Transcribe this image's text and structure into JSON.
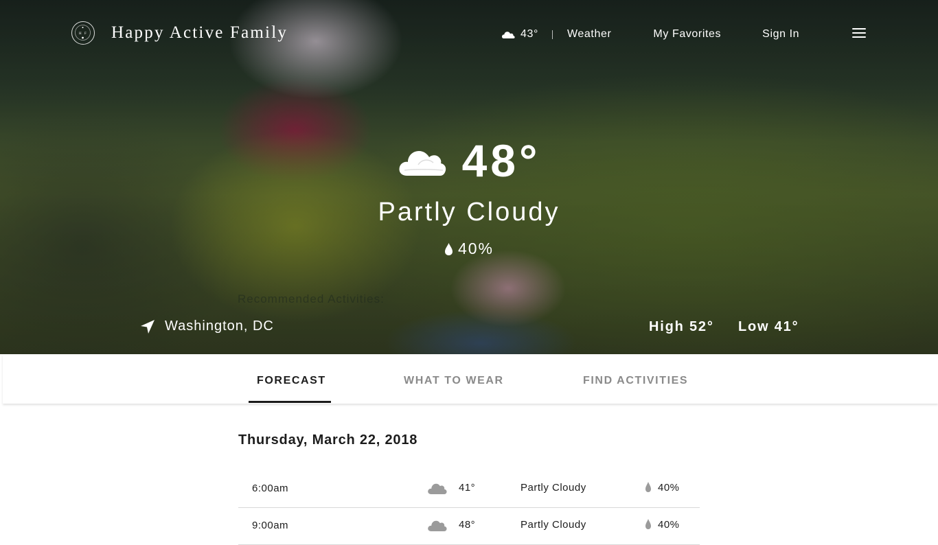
{
  "brand": {
    "name": "Happy Active Family"
  },
  "nav": {
    "weather_temp": "43°",
    "weather_icon": "cloud-icon",
    "links": [
      "Weather",
      "My Favorites",
      "Sign In"
    ],
    "menu_icon": "hamburger-menu-icon"
  },
  "current": {
    "temp": "48°",
    "condition": "Partly Cloudy",
    "precip": "40%",
    "ghost_text": "Recommended Activities:",
    "location": "Washington, DC",
    "high": "High 52°",
    "low": "Low 41°"
  },
  "tabs": [
    {
      "label": "FORECAST",
      "active": true
    },
    {
      "label": "WHAT TO WEAR",
      "active": false
    },
    {
      "label": "FIND ACTIVITIES",
      "active": false
    }
  ],
  "forecast": {
    "date": "Thursday, March 22, 2018",
    "rows": [
      {
        "time": "6:00am",
        "temp": "41°",
        "condition": "Partly Cloudy",
        "precip": "40%",
        "icon": "cloud-icon"
      },
      {
        "time": "9:00am",
        "temp": "48°",
        "condition": "Partly Cloudy",
        "precip": "40%",
        "icon": "cloud-icon"
      }
    ]
  },
  "colors": {
    "text_dark": "#1c1c1c",
    "tab_inactive": "#8a8a8a",
    "divider": "#d8d8d8",
    "forecast_icon": "#9b9b9b"
  }
}
